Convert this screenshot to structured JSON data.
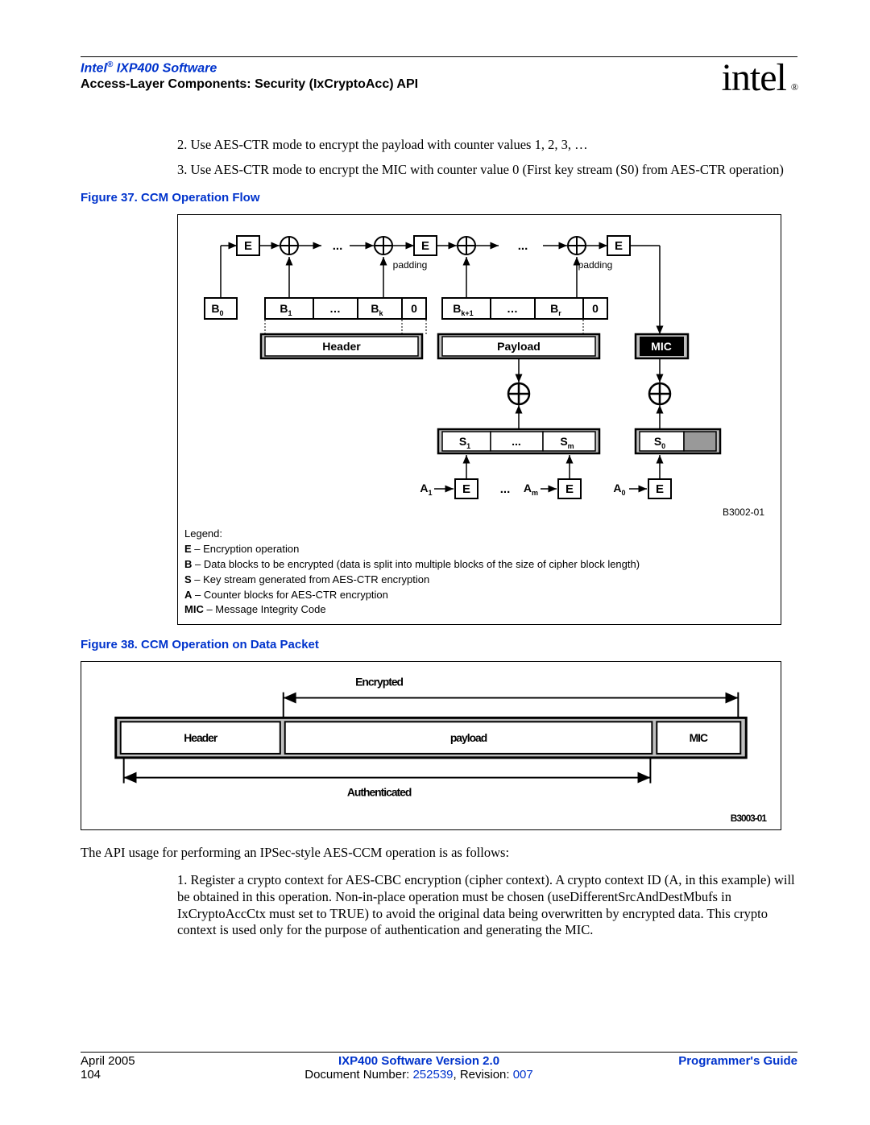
{
  "header": {
    "title_line1_a": "Intel",
    "title_line1_b": " IXP400 Software",
    "title_line2": "Access-Layer Components: Security (IxCryptoAcc) API",
    "logo": "intel",
    "reg": "®"
  },
  "steps": {
    "s2": "2.  Use AES-CTR mode to encrypt the payload with counter values 1, 2, 3, …",
    "s3": "3.  Use AES-CTR mode to encrypt the MIC with counter value 0 (First key stream (S0) from AES-CTR operation)"
  },
  "fig37": {
    "caption": "Figure 37. CCM Operation Flow",
    "labels": {
      "E": "E",
      "dots": "...",
      "ellipsis": "…",
      "padding": "padding",
      "B0": "B",
      "B0s": "0",
      "B1": "B",
      "B1s": "1",
      "Bk": "B",
      "Bks": "k",
      "zero": "0",
      "Bk1": "B",
      "Bk1s": "k+1",
      "Br": "B",
      "Brs": "r",
      "Header": "Header",
      "Payload": "Payload",
      "MIC": "MIC",
      "S1": "S",
      "S1s": "1",
      "Sm": "S",
      "Sms": "m",
      "S0": "S",
      "S0s": "0",
      "A1": "A",
      "A1s": "1",
      "Am": "A",
      "Ams": "m",
      "A0": "A",
      "A0s": "0",
      "code": "B3002-01"
    },
    "legend": {
      "title": "Legend:",
      "E": "E",
      "Et": " – Encryption operation",
      "B": "B",
      "Bt": " – Data blocks to be encrypted (data is split into multiple blocks of the size of cipher block length)",
      "S": "S",
      "St": " – Key stream generated from AES-CTR encryption",
      "A": "A",
      "At": " – Counter blocks for AES-CTR encryption",
      "MIC": "MIC",
      "MICt": " – Message Integrity Code"
    }
  },
  "fig38": {
    "caption": "Figure 38. CCM Operation on Data Packet",
    "labels": {
      "Encrypted": "Encrypted",
      "Header": "Header",
      "payload": "payload",
      "MIC": "MIC",
      "Authenticated": "Authenticated",
      "code": "B3003-01"
    }
  },
  "para1": "The API usage for performing an IPSec-style AES-CCM operation is as follows:",
  "list1": "1.  Register a crypto context for AES-CBC encryption (cipher context). A crypto context ID (A, in this example) will be obtained in this operation. Non-in-place operation must be chosen (useDifferentSrcAndDestMbufs in IxCryptoAccCtx must set to TRUE) to avoid the original data being overwritten by encrypted data. This crypto context is used only for the purpose of authentication and generating the MIC.",
  "footer": {
    "left1": "April 2005",
    "left2": "104",
    "center1": "IXP400 Software Version 2.0",
    "center2a": "Document Number: ",
    "center2b": "252539",
    "center2c": ", Revision: ",
    "center2d": "007",
    "right": "Programmer's Guide"
  }
}
